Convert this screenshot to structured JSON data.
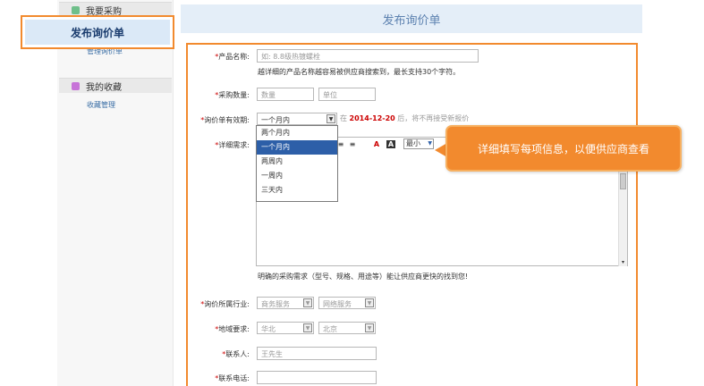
{
  "sidebar": {
    "group1": {
      "label": "我要采购"
    },
    "manage_inquiry": "管理询价单",
    "active": "发布询价单",
    "group2": {
      "label": "我的收藏"
    },
    "fav_manage": "收藏管理"
  },
  "main": {
    "title": "发布询价单"
  },
  "form": {
    "product_label": "产品名称:",
    "product_placeholder": "如: 8.8级热镀螺栓",
    "product_note": "越详细的产品名称越容易被供应商搜索到，最长支持30个字符。",
    "qty_label": "采购数量:",
    "qty_placeholder": "数量",
    "unit_placeholder": "单位",
    "validity_label": "询价单有效期:",
    "validity_selected": "一个月内",
    "validity_options": [
      "两个月内",
      "一个月内",
      "两周内",
      "一周内",
      "三天内"
    ],
    "date_prefix": "在",
    "date_value": "2014-12-20",
    "date_suffix": "后，将不再接受新报价",
    "details_label": "详细需求:",
    "font_size": "最小",
    "details_note": "明确的采购需求（型号、规格、用途等）能让供应商更快的找到您!",
    "industry_label": "询价所属行业:",
    "industry_1": "商务服务",
    "industry_2": "网络服务",
    "region_label": "地域要求:",
    "region_1": "华北",
    "region_2": "北京",
    "contact_label": "联系人:",
    "contact_placeholder": "王先生",
    "phone_label": "联系电话:",
    "required_mark": "*"
  },
  "callout": {
    "text": "详细填写每项信息，以便供应商查看"
  },
  "colors": {
    "accent": "#f28a2e",
    "title_bar": "#e4eef8",
    "selected": "#2d5fa8"
  }
}
